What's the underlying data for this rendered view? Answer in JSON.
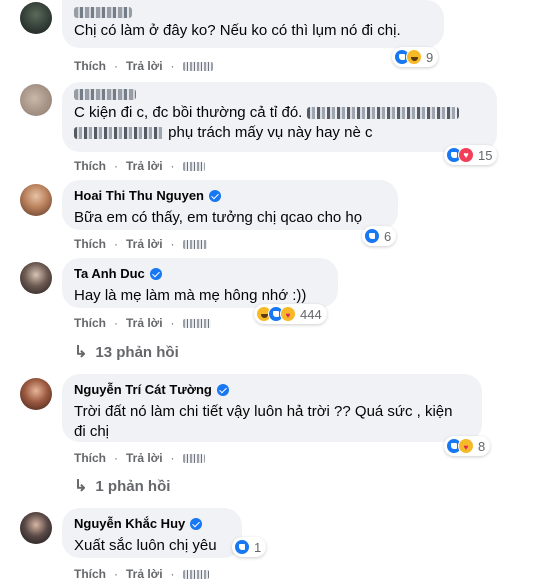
{
  "actions": {
    "like": "Thích",
    "reply": "Trả lời",
    "sep": "·"
  },
  "comments": [
    {
      "author": "",
      "text": "Chị có làm ở đây ko? Nếu ko có thì lụm nó đi chị.",
      "reactions": [
        "like-icon",
        "haha-icon"
      ],
      "count": "9"
    },
    {
      "author": "",
      "text_a": "C kiện đi c, đc bồi thường cả tỉ đó.",
      "text_b": "phụ trách mấy vụ này hay nè c",
      "reactions": [
        "like-icon",
        "love-icon"
      ],
      "count": "15"
    },
    {
      "author": "Hoai Thi Thu Nguyen",
      "text": "Bữa em có thấy, em tưởng chị qcao cho họ",
      "reactions": [
        "like-icon"
      ],
      "count": "6"
    },
    {
      "author": "Ta Anh Duc",
      "text": "Hay là mẹ làm mà mẹ hông nhớ :))",
      "reactions": [
        "haha-icon",
        "like-icon",
        "care-icon"
      ],
      "count": "444"
    },
    {
      "author": "Nguyễn Trí Cát Tường",
      "text_a": "Trời đất nó làm chi tiết vậy luôn hả trời ?? Quá sức , kiện",
      "text_b": "đi chị",
      "reactions": [
        "like-icon",
        "care-icon"
      ],
      "count": "8"
    },
    {
      "author": "Nguyễn Khắc Huy",
      "text": "Xuất sắc luôn chị yêu",
      "reactions": [
        "like-icon"
      ],
      "count": "1"
    }
  ],
  "reply_links": {
    "first": "13 phản hồi",
    "second": "1 phản hồi"
  },
  "colors": {
    "bubble": "#f0f2f5",
    "secondary_text": "#65676b",
    "verified": "#1877f2"
  }
}
